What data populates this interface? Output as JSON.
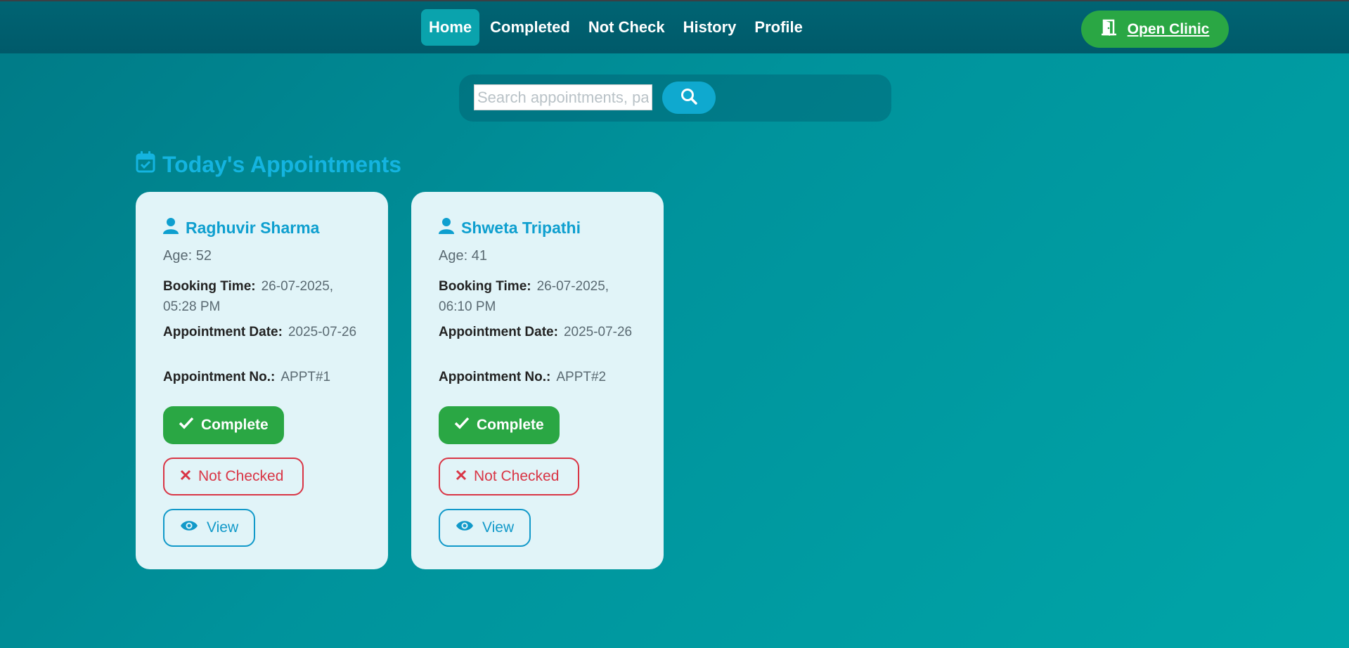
{
  "nav": {
    "items": [
      {
        "label": "Home",
        "active": true
      },
      {
        "label": "Completed",
        "active": false
      },
      {
        "label": "Not Check",
        "active": false
      },
      {
        "label": "History",
        "active": false
      },
      {
        "label": "Profile",
        "active": false
      }
    ],
    "open_clinic_label": "Open Clinic",
    "open_clinic_icon": "door-open-icon"
  },
  "search": {
    "placeholder": "Search appointments, pa",
    "value": "",
    "button_icon": "search-icon"
  },
  "section": {
    "title": "Today's Appointments",
    "icon": "calendar-check-icon"
  },
  "labels": {
    "booking_time": "Booking Time:",
    "appointment_date": "Appointment Date:",
    "appointment_no": "Appointment No.:",
    "complete": "Complete",
    "not_checked": "Not Checked",
    "view": "View"
  },
  "appointments": [
    {
      "name": "Raghuvir Sharma",
      "age": "Age: 52",
      "booking_time": "26-07-2025, 05:28 PM",
      "appointment_date": "2025-07-26",
      "appointment_no": "APPT#1"
    },
    {
      "name": "Shweta Tripathi",
      "age": "Age: 41",
      "booking_time": "26-07-2025, 06:10 PM",
      "appointment_date": "2025-07-26",
      "appointment_no": "APPT#2"
    }
  ],
  "colors": {
    "accent": "#14b4e0",
    "success": "#2aa744",
    "danger": "#d93545",
    "card_bg": "#e1f4f8",
    "nav_bg": "#005a6a"
  }
}
